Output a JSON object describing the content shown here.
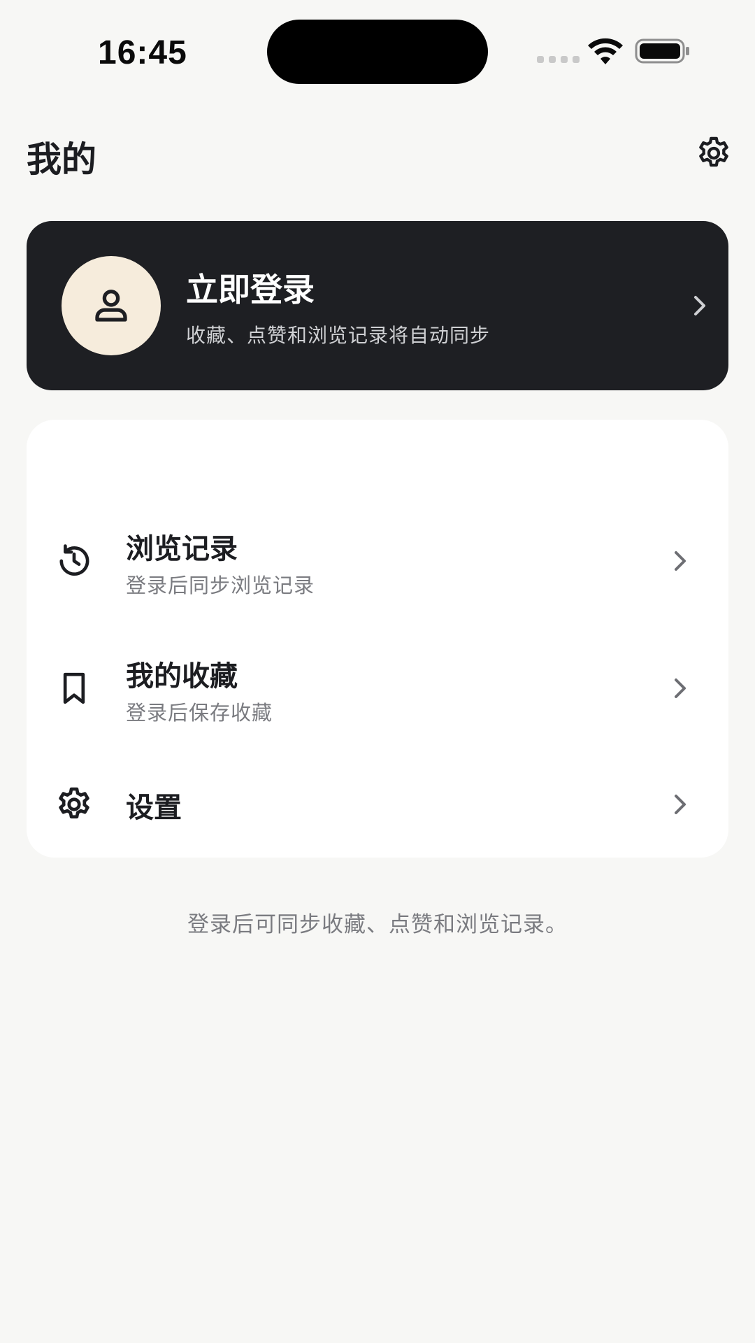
{
  "status_bar": {
    "time": "16:45"
  },
  "header": {
    "title": "我的"
  },
  "login_card": {
    "title": "立即登录",
    "subtitle": "收藏、点赞和浏览记录将自动同步"
  },
  "menu": {
    "items": [
      {
        "icon": "history-icon",
        "title": "浏览记录",
        "subtitle": "登录后同步浏览记录"
      },
      {
        "icon": "bookmark-icon",
        "title": "我的收藏",
        "subtitle": "登录后保存收藏"
      },
      {
        "icon": "gear-icon",
        "title": "设置"
      }
    ]
  },
  "footer": {
    "note": "登录后可同步收藏、点赞和浏览记录。"
  },
  "colors": {
    "background": "#f7f7f5",
    "card_dark": "#1e1f23",
    "avatar_bg": "#f6ecdc",
    "secondary_text": "#7a7b80"
  }
}
